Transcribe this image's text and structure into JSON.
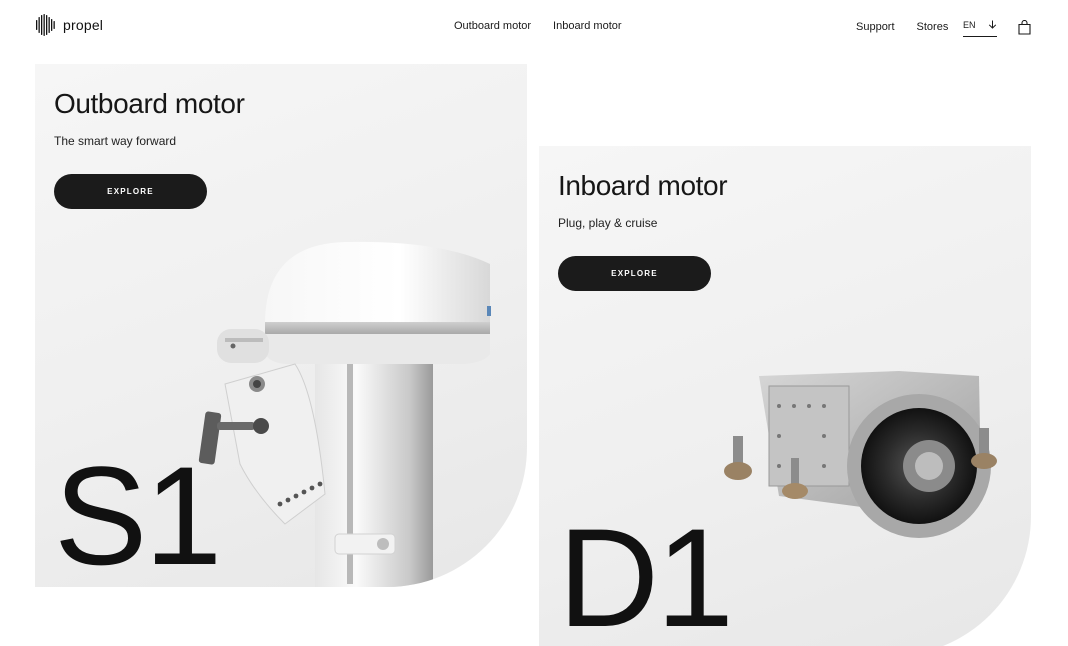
{
  "brand": {
    "name": "propel",
    "logo_icon": "propel-logo-icon"
  },
  "nav": {
    "center": [
      "Outboard motor",
      "Inboard motor"
    ],
    "right": [
      "Support",
      "Stores"
    ],
    "language": "EN",
    "language_icon": "arrow-down-icon",
    "cart_icon": "shopping-bag-icon"
  },
  "cards": {
    "s1": {
      "title": "Outboard motor",
      "subtitle": "The smart way forward",
      "button": "EXPLORE",
      "model": "S1"
    },
    "d1": {
      "title": "Inboard motor",
      "subtitle": "Plug, play & cruise",
      "button": "EXPLORE",
      "model": "D1"
    }
  },
  "colors": {
    "button_bg": "#1b1b1b",
    "card_bg": "#f2f2f2",
    "text": "#1a1a1a"
  }
}
